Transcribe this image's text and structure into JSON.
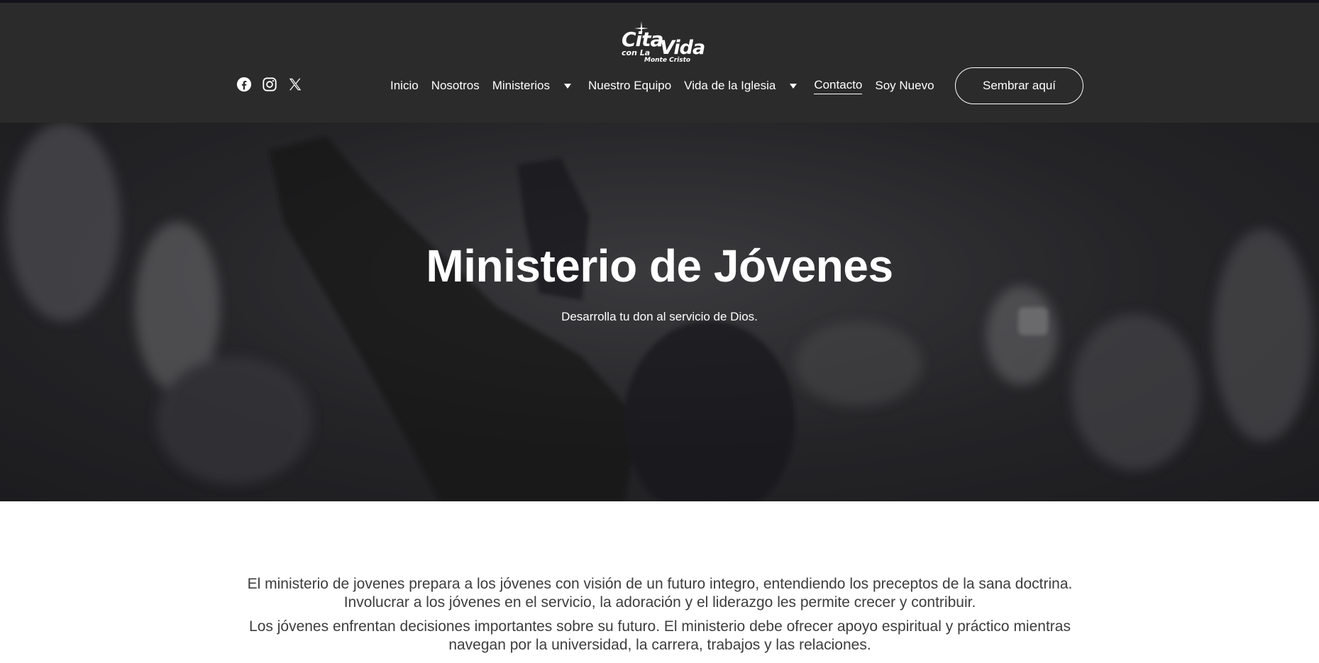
{
  "brand": {
    "logo_text_1": "Cita",
    "logo_text_2": "con La",
    "logo_text_3": "Vida",
    "logo_text_4": "Monte Cristo"
  },
  "socials": [
    {
      "icon": "facebook-icon"
    },
    {
      "icon": "instagram-icon"
    },
    {
      "icon": "x-icon"
    }
  ],
  "nav": {
    "items": [
      {
        "label": "Inicio",
        "dropdown": false,
        "active": false
      },
      {
        "label": "Nosotros",
        "dropdown": false,
        "active": false
      },
      {
        "label": "Ministerios",
        "dropdown": true,
        "active": false
      },
      {
        "label": "Nuestro Equipo",
        "dropdown": false,
        "active": false
      },
      {
        "label": "Vida de la Iglesia",
        "dropdown": true,
        "active": false
      },
      {
        "label": "Contacto",
        "dropdown": false,
        "active": true
      },
      {
        "label": "Soy Nuevo",
        "dropdown": false,
        "active": false
      }
    ],
    "cta_label": "Sembrar aquí"
  },
  "hero": {
    "title": "Ministerio de Jóvenes",
    "subtitle": "Desarrolla tu don al servicio de Dios."
  },
  "content": {
    "paragraph_1": "El ministerio de jovenes prepara a los jóvenes con visión de un futuro integro, entendiendo los preceptos de la sana doctrina. Involucrar a los jóvenes en el servicio, la adoración y el liderazgo les permite crecer y contribuir.",
    "paragraph_2": "Los jóvenes enfrentan decisiones importantes sobre su futuro. El ministerio debe ofrecer apoyo espiritual y práctico mientras navegan por la universidad, la carrera, trabajos y las relaciones."
  },
  "colors": {
    "header_bg": "#2b2b2b",
    "hero_overlay": "#242427",
    "text_light": "#ffffff",
    "body_text": "#3d3d3d"
  }
}
